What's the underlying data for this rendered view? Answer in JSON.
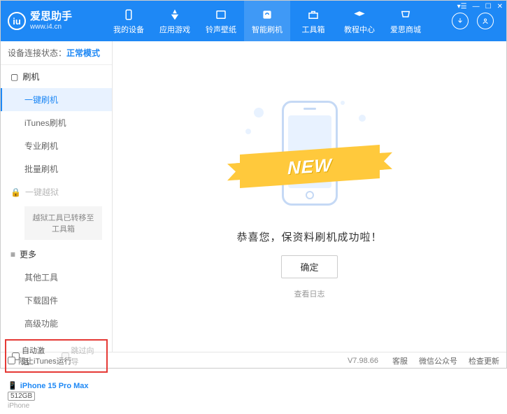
{
  "header": {
    "logo_text": "爱思助手",
    "logo_sub": "www.i4.cn",
    "nav": [
      {
        "label": "我的设备"
      },
      {
        "label": "应用游戏"
      },
      {
        "label": "铃声壁纸"
      },
      {
        "label": "智能刷机"
      },
      {
        "label": "工具箱"
      },
      {
        "label": "教程中心"
      },
      {
        "label": "爱思商城"
      }
    ]
  },
  "sidebar": {
    "conn_label": "设备连接状态：",
    "conn_mode": "正常模式",
    "section_flash": "刷机",
    "items_flash": [
      "一键刷机",
      "iTunes刷机",
      "专业刷机",
      "批量刷机"
    ],
    "section_jailbreak": "一键越狱",
    "jailbreak_note": "越狱工具已转移至工具箱",
    "section_more": "更多",
    "items_more": [
      "其他工具",
      "下载固件",
      "高级功能"
    ],
    "auto_activate": "自动激活",
    "skip_guide": "跳过向导",
    "device_name": "iPhone 15 Pro Max",
    "device_storage": "512GB",
    "device_type": "iPhone"
  },
  "main": {
    "ribbon": "NEW",
    "success": "恭喜您，保资料刷机成功啦！",
    "ok": "确定",
    "log": "查看日志"
  },
  "footer": {
    "block_itunes": "阻止iTunes运行",
    "version": "V7.98.66",
    "links": [
      "客服",
      "微信公众号",
      "检查更新"
    ]
  }
}
